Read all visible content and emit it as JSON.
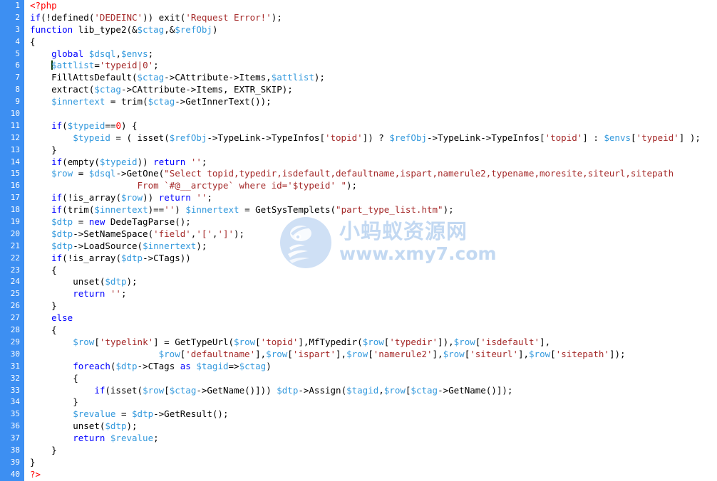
{
  "editor": {
    "language": "php",
    "total_lines": 40,
    "gutter_color": "#3d8ff2",
    "gutter_text_color": "#ffffff",
    "background_color": "#ffffff",
    "caret_line": 6,
    "colors": {
      "keyword": "#0000ff",
      "variable": "#3399dd",
      "string": "#a52a2a",
      "number": "#ff0000",
      "tag": "#ff0000",
      "plain": "#000000"
    }
  },
  "watermark": {
    "brand_cn": "小蚂蚁资源网",
    "brand_url": "www.xmy7.com",
    "color": "#c3d9f2",
    "logo_icon": "ant-circle-logo-icon"
  },
  "line_numbers": [
    "1",
    "2",
    "3",
    "4",
    "5",
    "6",
    "7",
    "8",
    "9",
    "10",
    "11",
    "12",
    "13",
    "14",
    "15",
    "16",
    "17",
    "18",
    "19",
    "20",
    "21",
    "22",
    "23",
    "24",
    "25",
    "26",
    "27",
    "28",
    "29",
    "30",
    "31",
    "32",
    "33",
    "34",
    "35",
    "36",
    "37",
    "38",
    "39",
    "40"
  ],
  "code_lines": [
    "<?php",
    "if(!defined('DEDEINC')) exit('Request Error!');",
    "function lib_type2(&$ctag,&$refObj)",
    "{",
    "    global $dsql,$envs;",
    "    $attlist='typeid|0';",
    "    FillAttsDefault($ctag->CAttribute->Items,$attlist);",
    "    extract($ctag->CAttribute->Items, EXTR_SKIP);",
    "    $innertext = trim($ctag->GetInnerText());",
    "",
    "    if($typeid==0) {",
    "        $typeid = ( isset($refObj->TypeLink->TypeInfos['topid']) ? $refObj->TypeLink->TypeInfos['topid'] : $envs['typeid'] );",
    "    }",
    "    if(empty($typeid)) return '';",
    "    $row = $dsql->GetOne(\"Select topid,typedir,isdefault,defaultname,ispart,namerule2,typename,moresite,siteurl,sitepath",
    "                    From `#@__arctype` where id='$typeid' \");",
    "    if(!is_array($row)) return '';",
    "    if(trim($innertext)=='') $innertext = GetSysTemplets(\"part_type_list.htm\");",
    "    $dtp = new DedeTagParse();",
    "    $dtp->SetNameSpace('field','[',']');",
    "    $dtp->LoadSource($innertext);",
    "    if(!is_array($dtp->CTags))",
    "    {",
    "        unset($dtp);",
    "        return '';",
    "    }",
    "    else",
    "    {",
    "        $row['typelink'] = GetTypeUrl($row['topid'],MfTypedir($row['typedir']),$row['isdefault'],",
    "                        $row['defaultname'],$row['ispart'],$row['namerule2'],$row['siteurl'],$row['sitepath']);",
    "        foreach($dtp->CTags as $tagid=>$ctag)",
    "        {",
    "            if(isset($row[$ctag->GetName()])) $dtp->Assign($tagid,$row[$ctag->GetName()]);",
    "        }",
    "        $revalue = $dtp->GetResult();",
    "        unset($dtp);",
    "        return $revalue;",
    "    }",
    "}",
    "?>"
  ],
  "tokens": [
    [
      [
        "<?php",
        "tag"
      ]
    ],
    [
      [
        "if",
        "kw"
      ],
      [
        "(!",
        "pun"
      ],
      [
        "defined",
        "fn"
      ],
      [
        "(",
        "pun"
      ],
      [
        "'DEDEINC'",
        "str"
      ],
      [
        "))",
        "pun"
      ],
      [
        " ",
        "pun"
      ],
      [
        "exit",
        "fn"
      ],
      [
        "(",
        "pun"
      ],
      [
        "'Request Error!'",
        "str"
      ],
      [
        ");",
        "pun"
      ]
    ],
    [
      [
        "function",
        "kw"
      ],
      [
        " ",
        "pun"
      ],
      [
        "lib_type2",
        "fn"
      ],
      [
        "(&",
        "pun"
      ],
      [
        "$ctag",
        "var"
      ],
      [
        ",&",
        "pun"
      ],
      [
        "$refObj",
        "var"
      ],
      [
        ")",
        "pun"
      ]
    ],
    [
      [
        "{",
        "pun"
      ]
    ],
    [
      [
        "    ",
        "pun"
      ],
      [
        "global",
        "kw"
      ],
      [
        " ",
        "pun"
      ],
      [
        "$dsql",
        "var"
      ],
      [
        ",",
        "pun"
      ],
      [
        "$envs",
        "var"
      ],
      [
        ";",
        "pun"
      ]
    ],
    [
      [
        "    ",
        "pun"
      ],
      [
        "CARET",
        "caret"
      ],
      [
        "$attlist",
        "var"
      ],
      [
        "=",
        "pun"
      ],
      [
        "'typeid|0'",
        "str"
      ],
      [
        ";",
        "pun"
      ]
    ],
    [
      [
        "    ",
        "pun"
      ],
      [
        "FillAttsDefault",
        "fn"
      ],
      [
        "(",
        "pun"
      ],
      [
        "$ctag",
        "var"
      ],
      [
        "->CAttribute->Items,",
        "pun"
      ],
      [
        "$attlist",
        "var"
      ],
      [
        ");",
        "pun"
      ]
    ],
    [
      [
        "    ",
        "pun"
      ],
      [
        "extract",
        "fn"
      ],
      [
        "(",
        "pun"
      ],
      [
        "$ctag",
        "var"
      ],
      [
        "->CAttribute->Items, EXTR_SKIP);",
        "pun"
      ]
    ],
    [
      [
        "    ",
        "pun"
      ],
      [
        "$innertext",
        "var"
      ],
      [
        " = ",
        "pun"
      ],
      [
        "trim",
        "fn"
      ],
      [
        "(",
        "pun"
      ],
      [
        "$ctag",
        "var"
      ],
      [
        "->GetInnerText());",
        "pun"
      ]
    ],
    [],
    [
      [
        "    ",
        "pun"
      ],
      [
        "if",
        "kw"
      ],
      [
        "(",
        "pun"
      ],
      [
        "$typeid",
        "var"
      ],
      [
        "==",
        "pun"
      ],
      [
        "0",
        "num"
      ],
      [
        ") {",
        "pun"
      ]
    ],
    [
      [
        "        ",
        "pun"
      ],
      [
        "$typeid",
        "var"
      ],
      [
        " = ( ",
        "pun"
      ],
      [
        "isset",
        "fn"
      ],
      [
        "(",
        "pun"
      ],
      [
        "$refObj",
        "var"
      ],
      [
        "->TypeLink->TypeInfos[",
        "pun"
      ],
      [
        "'topid'",
        "str"
      ],
      [
        "]) ? ",
        "pun"
      ],
      [
        "$refObj",
        "var"
      ],
      [
        "->TypeLink->TypeInfos[",
        "pun"
      ],
      [
        "'topid'",
        "str"
      ],
      [
        "] : ",
        "pun"
      ],
      [
        "$envs",
        "var"
      ],
      [
        "[",
        "pun"
      ],
      [
        "'typeid'",
        "str"
      ],
      [
        "] );",
        "pun"
      ]
    ],
    [
      [
        "    }",
        "pun"
      ]
    ],
    [
      [
        "    ",
        "pun"
      ],
      [
        "if",
        "kw"
      ],
      [
        "(",
        "pun"
      ],
      [
        "empty",
        "fn"
      ],
      [
        "(",
        "pun"
      ],
      [
        "$typeid",
        "var"
      ],
      [
        ")) ",
        "pun"
      ],
      [
        "return",
        "kw"
      ],
      [
        " ",
        "pun"
      ],
      [
        "''",
        "str"
      ],
      [
        ";",
        "pun"
      ]
    ],
    [
      [
        "    ",
        "pun"
      ],
      [
        "$row",
        "var"
      ],
      [
        " = ",
        "pun"
      ],
      [
        "$dsql",
        "var"
      ],
      [
        "->GetOne(",
        "pun"
      ],
      [
        "\"Select topid,typedir,isdefault,defaultname,ispart,namerule2,typename,moresite,siteurl,sitepath",
        "str"
      ]
    ],
    [
      [
        "                    ",
        "pun"
      ],
      [
        "From `#@__arctype` where id='$typeid' \"",
        "str"
      ],
      [
        ");",
        "pun"
      ]
    ],
    [
      [
        "    ",
        "pun"
      ],
      [
        "if",
        "kw"
      ],
      [
        "(!",
        "pun"
      ],
      [
        "is_array",
        "fn"
      ],
      [
        "(",
        "pun"
      ],
      [
        "$row",
        "var"
      ],
      [
        ")) ",
        "pun"
      ],
      [
        "return",
        "kw"
      ],
      [
        " ",
        "pun"
      ],
      [
        "''",
        "str"
      ],
      [
        ";",
        "pun"
      ]
    ],
    [
      [
        "    ",
        "pun"
      ],
      [
        "if",
        "kw"
      ],
      [
        "(",
        "pun"
      ],
      [
        "trim",
        "fn"
      ],
      [
        "(",
        "pun"
      ],
      [
        "$innertext",
        "var"
      ],
      [
        ")==",
        "pun"
      ],
      [
        "''",
        "str"
      ],
      [
        ") ",
        "pun"
      ],
      [
        "$innertext",
        "var"
      ],
      [
        " = ",
        "pun"
      ],
      [
        "GetSysTemplets",
        "fn"
      ],
      [
        "(",
        "pun"
      ],
      [
        "\"part_type_list.htm\"",
        "str"
      ],
      [
        ");",
        "pun"
      ]
    ],
    [
      [
        "    ",
        "pun"
      ],
      [
        "$dtp",
        "var"
      ],
      [
        " = ",
        "pun"
      ],
      [
        "new",
        "kw"
      ],
      [
        " ",
        "pun"
      ],
      [
        "DedeTagParse",
        "fn"
      ],
      [
        "();",
        "pun"
      ]
    ],
    [
      [
        "    ",
        "pun"
      ],
      [
        "$dtp",
        "var"
      ],
      [
        "->SetNameSpace(",
        "pun"
      ],
      [
        "'field'",
        "str"
      ],
      [
        ",",
        "pun"
      ],
      [
        "'['",
        "str"
      ],
      [
        ",",
        "pun"
      ],
      [
        "']'",
        "str"
      ],
      [
        ");",
        "pun"
      ]
    ],
    [
      [
        "    ",
        "pun"
      ],
      [
        "$dtp",
        "var"
      ],
      [
        "->LoadSource(",
        "pun"
      ],
      [
        "$innertext",
        "var"
      ],
      [
        ");",
        "pun"
      ]
    ],
    [
      [
        "    ",
        "pun"
      ],
      [
        "if",
        "kw"
      ],
      [
        "(!",
        "pun"
      ],
      [
        "is_array",
        "fn"
      ],
      [
        "(",
        "pun"
      ],
      [
        "$dtp",
        "var"
      ],
      [
        "->CTags))",
        "pun"
      ]
    ],
    [
      [
        "    {",
        "pun"
      ]
    ],
    [
      [
        "        ",
        "pun"
      ],
      [
        "unset",
        "fn"
      ],
      [
        "(",
        "pun"
      ],
      [
        "$dtp",
        "var"
      ],
      [
        ");",
        "pun"
      ]
    ],
    [
      [
        "        ",
        "pun"
      ],
      [
        "return",
        "kw"
      ],
      [
        " ",
        "pun"
      ],
      [
        "''",
        "str"
      ],
      [
        ";",
        "pun"
      ]
    ],
    [
      [
        "    }",
        "pun"
      ]
    ],
    [
      [
        "    ",
        "pun"
      ],
      [
        "else",
        "kw"
      ]
    ],
    [
      [
        "    {",
        "pun"
      ]
    ],
    [
      [
        "        ",
        "pun"
      ],
      [
        "$row",
        "var"
      ],
      [
        "[",
        "pun"
      ],
      [
        "'typelink'",
        "str"
      ],
      [
        "] = ",
        "pun"
      ],
      [
        "GetTypeUrl",
        "fn"
      ],
      [
        "(",
        "pun"
      ],
      [
        "$row",
        "var"
      ],
      [
        "[",
        "pun"
      ],
      [
        "'topid'",
        "str"
      ],
      [
        "],",
        "pun"
      ],
      [
        "MfTypedir",
        "fn"
      ],
      [
        "(",
        "pun"
      ],
      [
        "$row",
        "var"
      ],
      [
        "[",
        "pun"
      ],
      [
        "'typedir'",
        "str"
      ],
      [
        "]),",
        "pun"
      ],
      [
        "$row",
        "var"
      ],
      [
        "[",
        "pun"
      ],
      [
        "'isdefault'",
        "str"
      ],
      [
        "],",
        "pun"
      ]
    ],
    [
      [
        "                        ",
        "pun"
      ],
      [
        "$row",
        "var"
      ],
      [
        "[",
        "pun"
      ],
      [
        "'defaultname'",
        "str"
      ],
      [
        "],",
        "pun"
      ],
      [
        "$row",
        "var"
      ],
      [
        "[",
        "pun"
      ],
      [
        "'ispart'",
        "str"
      ],
      [
        "],",
        "pun"
      ],
      [
        "$row",
        "var"
      ],
      [
        "[",
        "pun"
      ],
      [
        "'namerule2'",
        "str"
      ],
      [
        "],",
        "pun"
      ],
      [
        "$row",
        "var"
      ],
      [
        "[",
        "pun"
      ],
      [
        "'siteurl'",
        "str"
      ],
      [
        "],",
        "pun"
      ],
      [
        "$row",
        "var"
      ],
      [
        "[",
        "pun"
      ],
      [
        "'sitepath'",
        "str"
      ],
      [
        "]);",
        "pun"
      ]
    ],
    [
      [
        "        ",
        "pun"
      ],
      [
        "foreach",
        "kw"
      ],
      [
        "(",
        "pun"
      ],
      [
        "$dtp",
        "var"
      ],
      [
        "->CTags ",
        "pun"
      ],
      [
        "as",
        "kw"
      ],
      [
        " ",
        "pun"
      ],
      [
        "$tagid",
        "var"
      ],
      [
        "=>",
        "pun"
      ],
      [
        "$ctag",
        "var"
      ],
      [
        ")",
        "pun"
      ]
    ],
    [
      [
        "        {",
        "pun"
      ]
    ],
    [
      [
        "            ",
        "pun"
      ],
      [
        "if",
        "kw"
      ],
      [
        "(",
        "pun"
      ],
      [
        "isset",
        "fn"
      ],
      [
        "(",
        "pun"
      ],
      [
        "$row",
        "var"
      ],
      [
        "[",
        "pun"
      ],
      [
        "$ctag",
        "var"
      ],
      [
        "->GetName()])) ",
        "pun"
      ],
      [
        "$dtp",
        "var"
      ],
      [
        "->Assign(",
        "pun"
      ],
      [
        "$tagid",
        "var"
      ],
      [
        ",",
        "pun"
      ],
      [
        "$row",
        "var"
      ],
      [
        "[",
        "pun"
      ],
      [
        "$ctag",
        "var"
      ],
      [
        "->GetName()]);",
        "pun"
      ]
    ],
    [
      [
        "        }",
        "pun"
      ]
    ],
    [
      [
        "        ",
        "pun"
      ],
      [
        "$revalue",
        "var"
      ],
      [
        " = ",
        "pun"
      ],
      [
        "$dtp",
        "var"
      ],
      [
        "->GetResult();",
        "pun"
      ]
    ],
    [
      [
        "        ",
        "pun"
      ],
      [
        "unset",
        "fn"
      ],
      [
        "(",
        "pun"
      ],
      [
        "$dtp",
        "var"
      ],
      [
        ");",
        "pun"
      ]
    ],
    [
      [
        "        ",
        "pun"
      ],
      [
        "return",
        "kw"
      ],
      [
        " ",
        "pun"
      ],
      [
        "$revalue",
        "var"
      ],
      [
        ";",
        "pun"
      ]
    ],
    [
      [
        "    }",
        "pun"
      ]
    ],
    [
      [
        "}",
        "pun"
      ]
    ],
    [
      [
        "?>",
        "tag"
      ]
    ]
  ]
}
